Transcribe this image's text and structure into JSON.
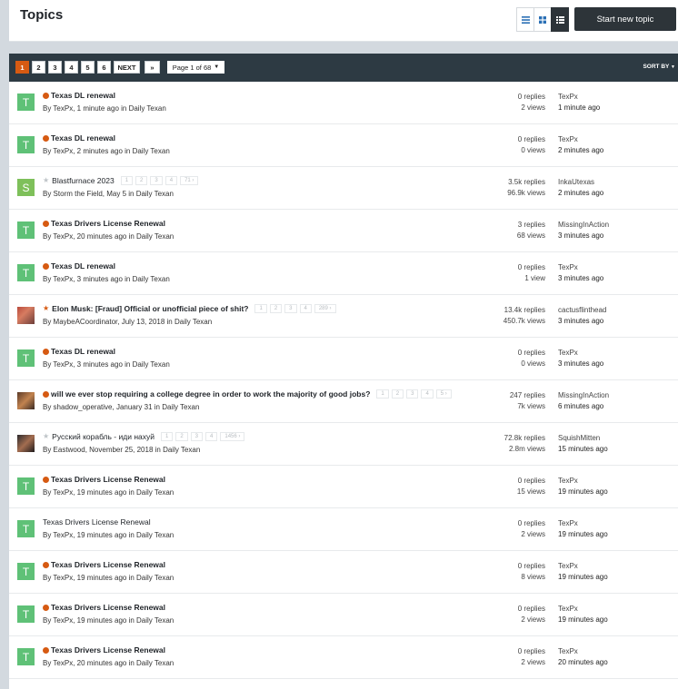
{
  "header": {
    "title": "Topics",
    "new_topic_label": "Start new topic",
    "views": [
      "table-view-icon",
      "grid-view-icon",
      "list-view-icon"
    ],
    "active_view": "list-view-icon"
  },
  "toolbar": {
    "pages": [
      "1",
      "2",
      "3",
      "4",
      "5",
      "6"
    ],
    "active_page": "1",
    "next_label": "NEXT",
    "last_label": "»",
    "page_jump": "Page 1 of 68",
    "sort_label": "SORT BY"
  },
  "colors": {
    "accent": "#d65a12",
    "toolbar_bg": "#2d3a43",
    "avatar_green": "#5fc177",
    "avatar_lime": "#7ec05a"
  },
  "topics": [
    {
      "avatar": "T",
      "status": "dot",
      "title": "Texas DL renewal",
      "bold": true,
      "pages": [],
      "author": "By TexPx, 1 minute ago in Daily Texan",
      "replies": "0 replies",
      "views": "2 views",
      "last_user": "TexPx",
      "last_time": "1 minute ago"
    },
    {
      "avatar": "T",
      "status": "dot",
      "title": "Texas DL renewal",
      "bold": true,
      "pages": [],
      "author": "By TexPx, 2 minutes ago in Daily Texan",
      "replies": "0 replies",
      "views": "0 views",
      "last_user": "TexPx",
      "last_time": "2 minutes ago"
    },
    {
      "avatar": "S",
      "status": "star-grey",
      "title": "Blastfurnace 2023",
      "bold": false,
      "pages": [
        "1",
        "2",
        "3",
        "4",
        "71"
      ],
      "author": "By Storm the Field, May 5 in Daily Texan",
      "replies": "3.5k replies",
      "views": "96.9k views",
      "last_user": "InkaUtexas",
      "last_time": "2 minutes ago"
    },
    {
      "avatar": "T",
      "status": "dot",
      "title": "Texas Drivers License Renewal",
      "bold": true,
      "pages": [],
      "author": "By TexPx, 20 minutes ago in Daily Texan",
      "replies": "3 replies",
      "views": "68 views",
      "last_user": "MissingInAction",
      "last_time": "3 minutes ago"
    },
    {
      "avatar": "T",
      "status": "dot",
      "title": "Texas DL renewal",
      "bold": true,
      "pages": [],
      "author": "By TexPx, 3 minutes ago in Daily Texan",
      "replies": "0 replies",
      "views": "1 view",
      "last_user": "TexPx",
      "last_time": "3 minutes ago"
    },
    {
      "avatar": "photo1",
      "status": "star-orange",
      "title": "Elon Musk: [Fraud] Official or unofficial piece of shit?",
      "bold": true,
      "pages": [
        "1",
        "2",
        "3",
        "4",
        "289"
      ],
      "author": "By MaybeACoordinator, July 13, 2018 in Daily Texan",
      "replies": "13.4k replies",
      "views": "450.7k views",
      "last_user": "cactusflinthead",
      "last_time": "3 minutes ago"
    },
    {
      "avatar": "T",
      "status": "dot",
      "title": "Texas DL renewal",
      "bold": true,
      "pages": [],
      "author": "By TexPx, 3 minutes ago in Daily Texan",
      "replies": "0 replies",
      "views": "0 views",
      "last_user": "TexPx",
      "last_time": "3 minutes ago"
    },
    {
      "avatar": "photo2",
      "status": "dot",
      "title": "will we ever stop requiring a college degree in order to work the majority of good jobs?",
      "bold": true,
      "pages": [
        "1",
        "2",
        "3",
        "4",
        "5"
      ],
      "author": "By shadow_operative, January 31 in Daily Texan",
      "replies": "247 replies",
      "views": "7k views",
      "last_user": "MissingInAction",
      "last_time": "6 minutes ago"
    },
    {
      "avatar": "photo3",
      "status": "star-grey",
      "title": "Русский корабль - иди нахуй",
      "bold": false,
      "pages": [
        "1",
        "2",
        "3",
        "4",
        "1456"
      ],
      "author": "By Eastwood, November 25, 2018 in Daily Texan",
      "replies": "72.8k replies",
      "views": "2.8m views",
      "last_user": "SquishMitten",
      "last_time": "15 minutes ago"
    },
    {
      "avatar": "T",
      "status": "dot",
      "title": "Texas Drivers License Renewal",
      "bold": true,
      "pages": [],
      "author": "By TexPx, 19 minutes ago in Daily Texan",
      "replies": "0 replies",
      "views": "15 views",
      "last_user": "TexPx",
      "last_time": "19 minutes ago"
    },
    {
      "avatar": "T",
      "status": "none",
      "title": "Texas Drivers License Renewal",
      "bold": false,
      "pages": [],
      "author": "By TexPx, 19 minutes ago in Daily Texan",
      "replies": "0 replies",
      "views": "2 views",
      "last_user": "TexPx",
      "last_time": "19 minutes ago"
    },
    {
      "avatar": "T",
      "status": "dot",
      "title": "Texas Drivers License Renewal",
      "bold": true,
      "pages": [],
      "author": "By TexPx, 19 minutes ago in Daily Texan",
      "replies": "0 replies",
      "views": "8 views",
      "last_user": "TexPx",
      "last_time": "19 minutes ago"
    },
    {
      "avatar": "T",
      "status": "dot",
      "title": "Texas Drivers License Renewal",
      "bold": true,
      "pages": [],
      "author": "By TexPx, 19 minutes ago in Daily Texan",
      "replies": "0 replies",
      "views": "2 views",
      "last_user": "TexPx",
      "last_time": "19 minutes ago"
    },
    {
      "avatar": "T",
      "status": "dot",
      "title": "Texas Drivers License Renewal",
      "bold": true,
      "pages": [],
      "author": "By TexPx, 20 minutes ago in Daily Texan",
      "replies": "0 replies",
      "views": "2 views",
      "last_user": "TexPx",
      "last_time": "20 minutes ago"
    }
  ]
}
